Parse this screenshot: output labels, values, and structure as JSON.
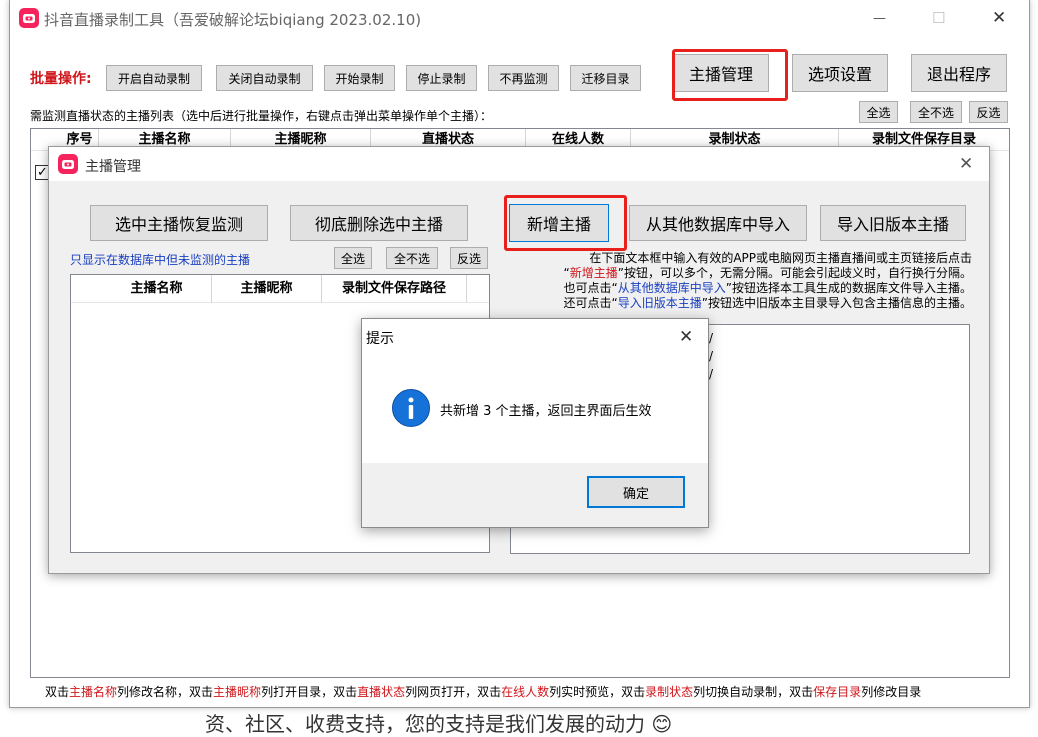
{
  "main_window": {
    "title": "抖音直播录制工具（吾爱破解论坛biqiang 2023.02.10)",
    "minimize": "—",
    "maximize": "☐",
    "close": "✕",
    "batch_label": "批量操作:",
    "batch_buttons": [
      "开启自动录制",
      "关闭自动录制",
      "开始录制",
      "停止录制",
      "不再监测",
      "迁移目录"
    ],
    "top_buttons": {
      "streamer_manage": "主播管理",
      "options": "选项设置",
      "exit": "退出程序"
    },
    "list_hint": "需监测直播状态的主播列表（选中后进行批量操作，右键点击弹出菜单操作单个主播）：",
    "select_buttons": {
      "all": "全选",
      "none": "全不选",
      "invert": "反选"
    },
    "table_headers": [
      "序号",
      "主播名称",
      "主播昵称",
      "直播状态",
      "在线人数",
      "录制状态",
      "录制文件保存目录"
    ],
    "footer_segments": [
      {
        "text": "双击",
        "red": false
      },
      {
        "text": "主播名称",
        "red": true
      },
      {
        "text": "列修改名称，双击",
        "red": false
      },
      {
        "text": "主播昵称",
        "red": true
      },
      {
        "text": "列打开目录，双击",
        "red": false
      },
      {
        "text": "直播状态",
        "red": true
      },
      {
        "text": "列网页打开，双击",
        "red": false
      },
      {
        "text": "在线人数",
        "red": true
      },
      {
        "text": "列实时预览，双击",
        "red": false
      },
      {
        "text": "录制状态",
        "red": true
      },
      {
        "text": "列切换自动录制，双击",
        "red": false
      },
      {
        "text": "保存目录",
        "red": true
      },
      {
        "text": "列修改目录",
        "red": false
      }
    ],
    "behind_text": "资、社区、收费支持，您的支持是我们发展的动力 😊"
  },
  "manage_dialog": {
    "title": "主播管理",
    "close": "✕",
    "restore_button": "选中主播恢复监测",
    "delete_button": "彻底删除选中主播",
    "add_button": "新增主播",
    "import_db_button": "从其他数据库中导入",
    "import_old_button": "导入旧版本主播",
    "unmonitored_hint": "只显示在数据库中但未监测的主播",
    "select_buttons": {
      "all": "全选",
      "none": "全不选",
      "invert": "反选"
    },
    "list_headers": [
      "主播名称",
      "主播昵称",
      "录制文件保存路径"
    ],
    "instructions": [
      [
        {
          "text": "在下面文本框中输入有效的APP或电脑网页主播直播间或主页链接后点击",
          "style": "normal"
        }
      ],
      [
        {
          "text": "“",
          "style": "normal"
        },
        {
          "text": "新增主播",
          "style": "red"
        },
        {
          "text": "”按钮，可以多个，无需分隔。可能会引起歧义时，自行换行分隔。",
          "style": "normal"
        }
      ],
      [
        {
          "text": "也可点击“",
          "style": "normal"
        },
        {
          "text": "从其他数据库中导入",
          "style": "blue"
        },
        {
          "text": "”按钮选择本工具生成的数据库文件导入主播。",
          "style": "normal"
        }
      ],
      [
        {
          "text": "还可点击“",
          "style": "normal"
        },
        {
          "text": "导入旧版本主播",
          "style": "blue"
        },
        {
          "text": "”按钮选中旧版本主目录导入包含主播信息的主播。",
          "style": "normal"
        }
      ]
    ],
    "textarea_lines": [
      "/",
      "/",
      "/"
    ]
  },
  "message_box": {
    "title": "提示",
    "close": "✕",
    "icon": "info-icon",
    "message": "共新增 3 个主播，返回主界面后生效",
    "ok": "确定"
  },
  "colors": {
    "accent_red": "#e8201c",
    "app_icon": "#f5245c",
    "info_blue": "#1672d8"
  }
}
